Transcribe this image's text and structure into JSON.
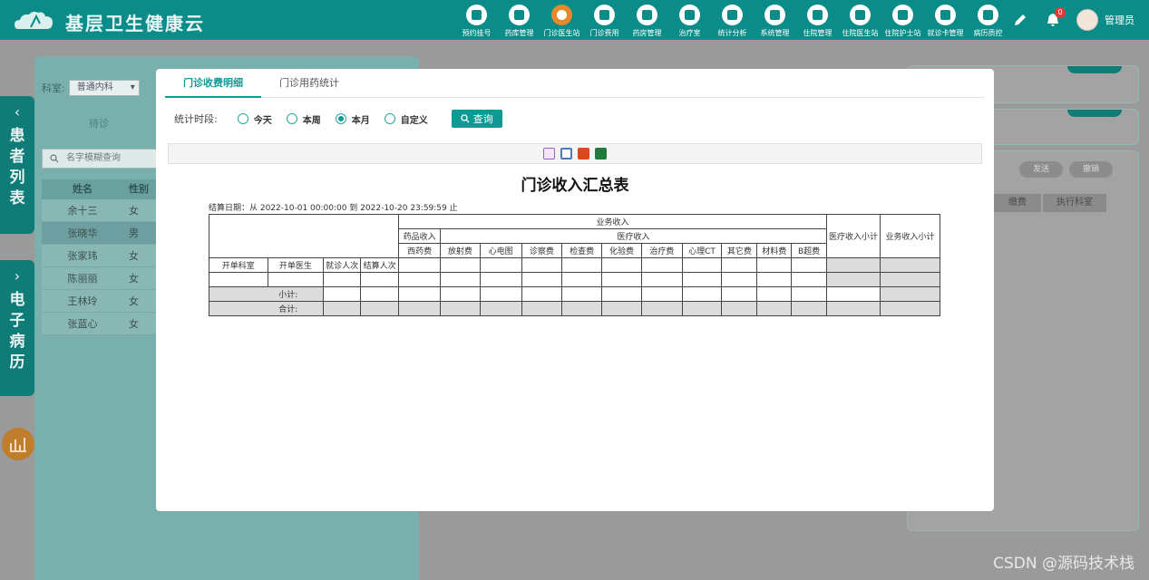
{
  "app": {
    "title": "基层卫生健康云"
  },
  "nav": [
    {
      "label": "预约挂号"
    },
    {
      "label": "药库管理"
    },
    {
      "label": "门诊医生站",
      "active": true
    },
    {
      "label": "门诊费用"
    },
    {
      "label": "药房管理"
    },
    {
      "label": "治疗室"
    },
    {
      "label": "统计分析"
    },
    {
      "label": "系统管理"
    },
    {
      "label": "住院管理"
    },
    {
      "label": "住院医生站"
    },
    {
      "label": "住院护士站"
    },
    {
      "label": "就诊卡管理"
    },
    {
      "label": "病历质控"
    }
  ],
  "header": {
    "notification_count": "0",
    "user_name": "管理员"
  },
  "side_tabs": {
    "patient_list": "患者列表",
    "emr": "电子病历"
  },
  "patient_panel": {
    "dept_label": "科室:",
    "dept_value": "普通内科",
    "waiting_label": "待诊",
    "search_placeholder": "名字模糊查询",
    "col_name": "姓名",
    "col_sex": "性别",
    "patients": [
      {
        "name": "余十三",
        "sex": "女"
      },
      {
        "name": "张晓华",
        "sex": "男"
      },
      {
        "name": "张家玮",
        "sex": "女"
      },
      {
        "name": "陈丽丽",
        "sex": "女"
      },
      {
        "name": "王林玲",
        "sex": "女"
      },
      {
        "name": "张蓝心",
        "sex": "女"
      }
    ]
  },
  "right_panel": {
    "btn_send": "发送",
    "btn_cancel": "撤销",
    "col_fee": "缴费",
    "col_exec_dept": "执行科室"
  },
  "modal": {
    "tabs": [
      "门诊收费明细",
      "门诊用药统计"
    ],
    "period_label": "统计时段:",
    "periods": [
      {
        "label": "今天",
        "checked": false
      },
      {
        "label": "本周",
        "checked": false
      },
      {
        "label": "本月",
        "checked": true
      },
      {
        "label": "自定义",
        "checked": false
      }
    ],
    "query_label": "查询",
    "report": {
      "title": "门诊收入汇总表",
      "settle_text": "结算日期：从  2022-10-01 00:00:00  到  2022-10-20 23:59:59 止",
      "business_income": "业务收入",
      "drug_income": "药品收入",
      "medical_income": "医疗收入",
      "outpatient_subtotal": "医疗收入小计",
      "business_subtotal": "业务收入小计",
      "columns": [
        "开单科室",
        "开单医生",
        "就诊人次",
        "结算人次",
        "西药费",
        "放射费",
        "心电图",
        "诊察费",
        "检查费",
        "化验费",
        "治疗费",
        "心理CT",
        "其它费",
        "材料费",
        "B超费"
      ],
      "subtotal_label": "小计:",
      "total_label": "合计:"
    }
  },
  "watermark": "CSDN @源码技术栈"
}
